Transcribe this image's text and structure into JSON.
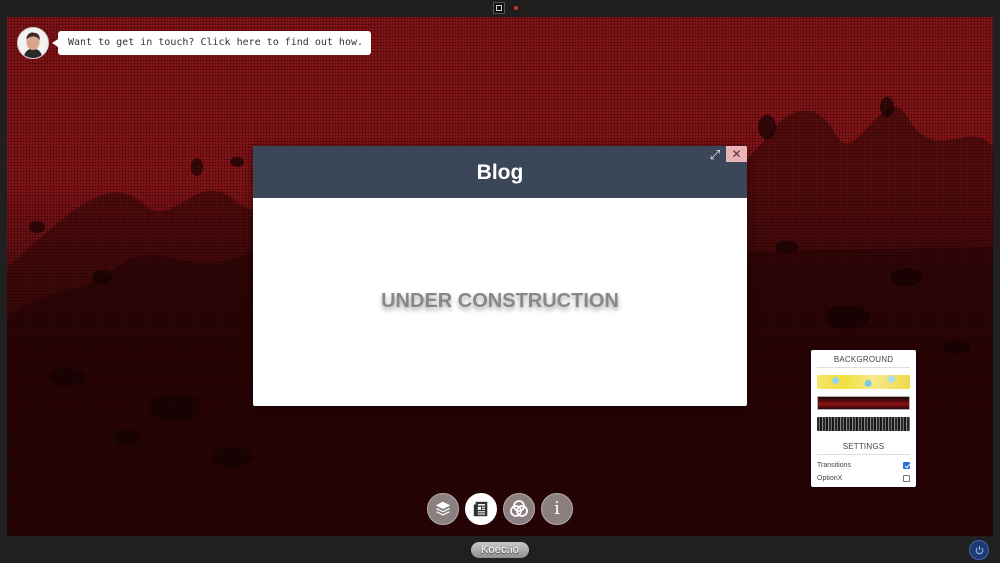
{
  "contact": {
    "message": "Want to get in touch? Click here to find out how."
  },
  "modal": {
    "title": "Blog",
    "body_text": "UNDER CONSTRUCTION",
    "expand_glyph": "⤢",
    "close_glyph": "✕"
  },
  "dock": {
    "items": [
      {
        "icon": "layers-icon",
        "active": false
      },
      {
        "icon": "blog-icon",
        "active": true
      },
      {
        "icon": "color-circles-icon",
        "active": false
      },
      {
        "icon": "info-icon",
        "active": false
      }
    ],
    "info_glyph": "i"
  },
  "settings_panel": {
    "background_heading": "BACKGROUND",
    "backgrounds": [
      "colorful",
      "red",
      "dark"
    ],
    "selected_background": "red",
    "settings_heading": "SETTINGS",
    "options": [
      {
        "label": "Transitions",
        "checked": true
      },
      {
        "label": "OptionX",
        "checked": false
      }
    ]
  },
  "footer": {
    "logo_text": "Koec.io"
  },
  "colors": {
    "modal_header": "#3b4658",
    "close_button": "#e8b4b8",
    "background_red": "#8c1418",
    "checkbox_accent": "#2c6fd6",
    "power_button": "#1e3a72"
  }
}
